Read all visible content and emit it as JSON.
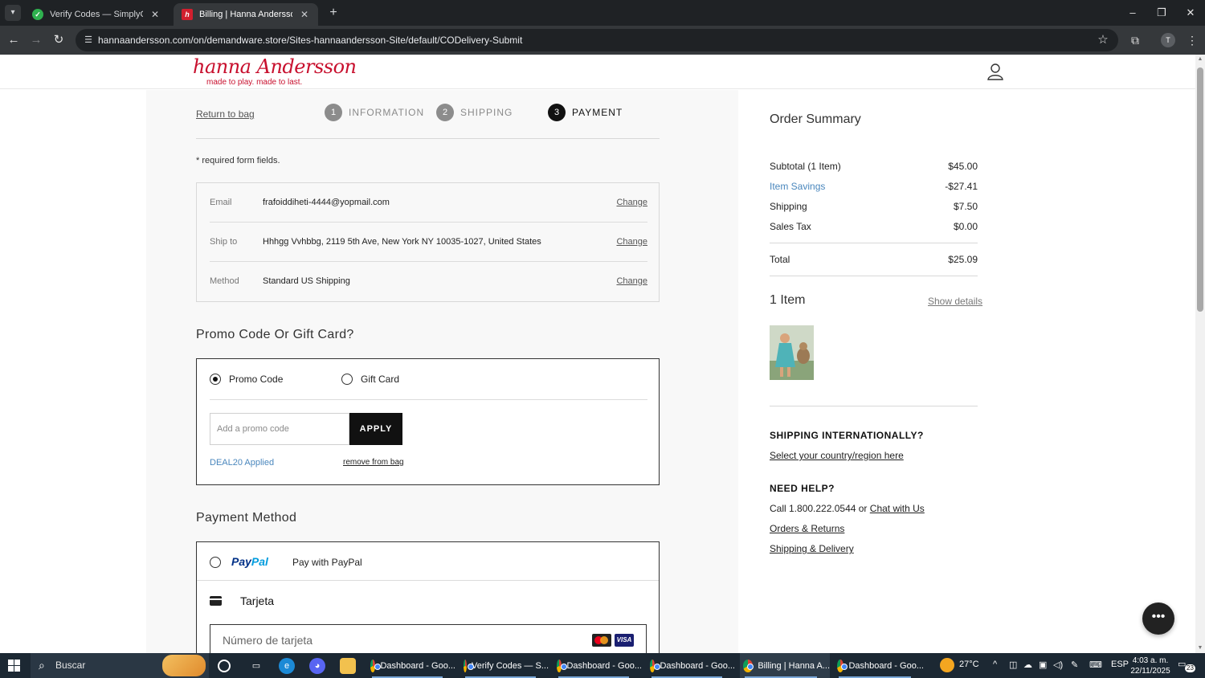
{
  "browser": {
    "tabs": [
      {
        "title": "Verify Codes — SimplyCodes",
        "favicon": "simplycodes-check-icon"
      },
      {
        "title": "Billing | Hanna Andersson",
        "favicon": "hanna-andersson-icon"
      }
    ],
    "url": "hannaandersson.com/on/demandware.store/Sites-hannaandersson-Site/default/CODelivery-Submit",
    "profile_initial": "T"
  },
  "header": {
    "logo_text": "hanna Andersson",
    "logo_tagline": "made to play. made to last."
  },
  "checkout": {
    "return_link": "Return to bag",
    "steps": [
      {
        "num": "1",
        "label": "INFORMATION"
      },
      {
        "num": "2",
        "label": "SHIPPING"
      },
      {
        "num": "3",
        "label": "PAYMENT"
      }
    ],
    "required_note": "* required form fields.",
    "summary": [
      {
        "key": "Email",
        "value": "frafoiddiheti-4444@yopmail.com",
        "action": "Change"
      },
      {
        "key": "Ship to",
        "value": "Hhhgg Vvhbbg, 2119 5th Ave, New York NY 10035-1027, United States",
        "action": "Change"
      },
      {
        "key": "Method",
        "value": "Standard US Shipping",
        "action": "Change"
      }
    ]
  },
  "promo": {
    "title": "Promo Code Or Gift Card?",
    "option_promo": "Promo Code",
    "option_gift": "Gift Card",
    "selected": "Promo Code",
    "input_placeholder": "Add a promo code",
    "apply_label": "APPLY",
    "applied_text": "DEAL20 Applied",
    "remove_link": "remove from bag"
  },
  "payment": {
    "title": "Payment Method",
    "paypal_logo_a": "Pay",
    "paypal_logo_b": "Pal",
    "paypal_label": "Pay with PayPal",
    "card_label": "Tarjeta",
    "card_placeholder": "Número de tarjeta",
    "visa_label": "VISA"
  },
  "order_summary": {
    "title": "Order Summary",
    "rows": [
      {
        "label": "Subtotal (1 Item)",
        "value": "$45.00"
      },
      {
        "label": "Item Savings",
        "value": "-$27.41"
      },
      {
        "label": "Shipping",
        "value": "$7.50"
      },
      {
        "label": "Sales Tax",
        "value": "$0.00"
      }
    ],
    "total_label": "Total",
    "total_value": "$25.09",
    "item_count": "1 Item",
    "show_details": "Show details"
  },
  "help": {
    "ship_int_title": "SHIPPING INTERNATIONALLY?",
    "ship_int_link": "Select your country/region here",
    "need_help_title": "NEED HELP?",
    "call_text": "Call 1.800.222.0544 or",
    "chat_link": "Chat with Us",
    "orders_link": "Orders & Returns",
    "shipping_link": "Shipping & Delivery"
  },
  "taskbar": {
    "search_label": "Buscar",
    "apps": [
      {
        "label": "Dashboard - Goo..."
      },
      {
        "label": "Verify Codes — S..."
      },
      {
        "label": "Dashboard - Goo..."
      },
      {
        "label": "Dashboard - Goo..."
      },
      {
        "label": "Billing | Hanna A..."
      },
      {
        "label": "Dashboard - Goo..."
      }
    ],
    "temperature": "27°C",
    "language": "ESP",
    "time": "4:03 a. m.",
    "date": "22/11/2025",
    "notification_count": "23"
  },
  "colors": {
    "brand_red": "#c8102e",
    "link_blue": "#4a87bd",
    "dark": "#111111"
  }
}
